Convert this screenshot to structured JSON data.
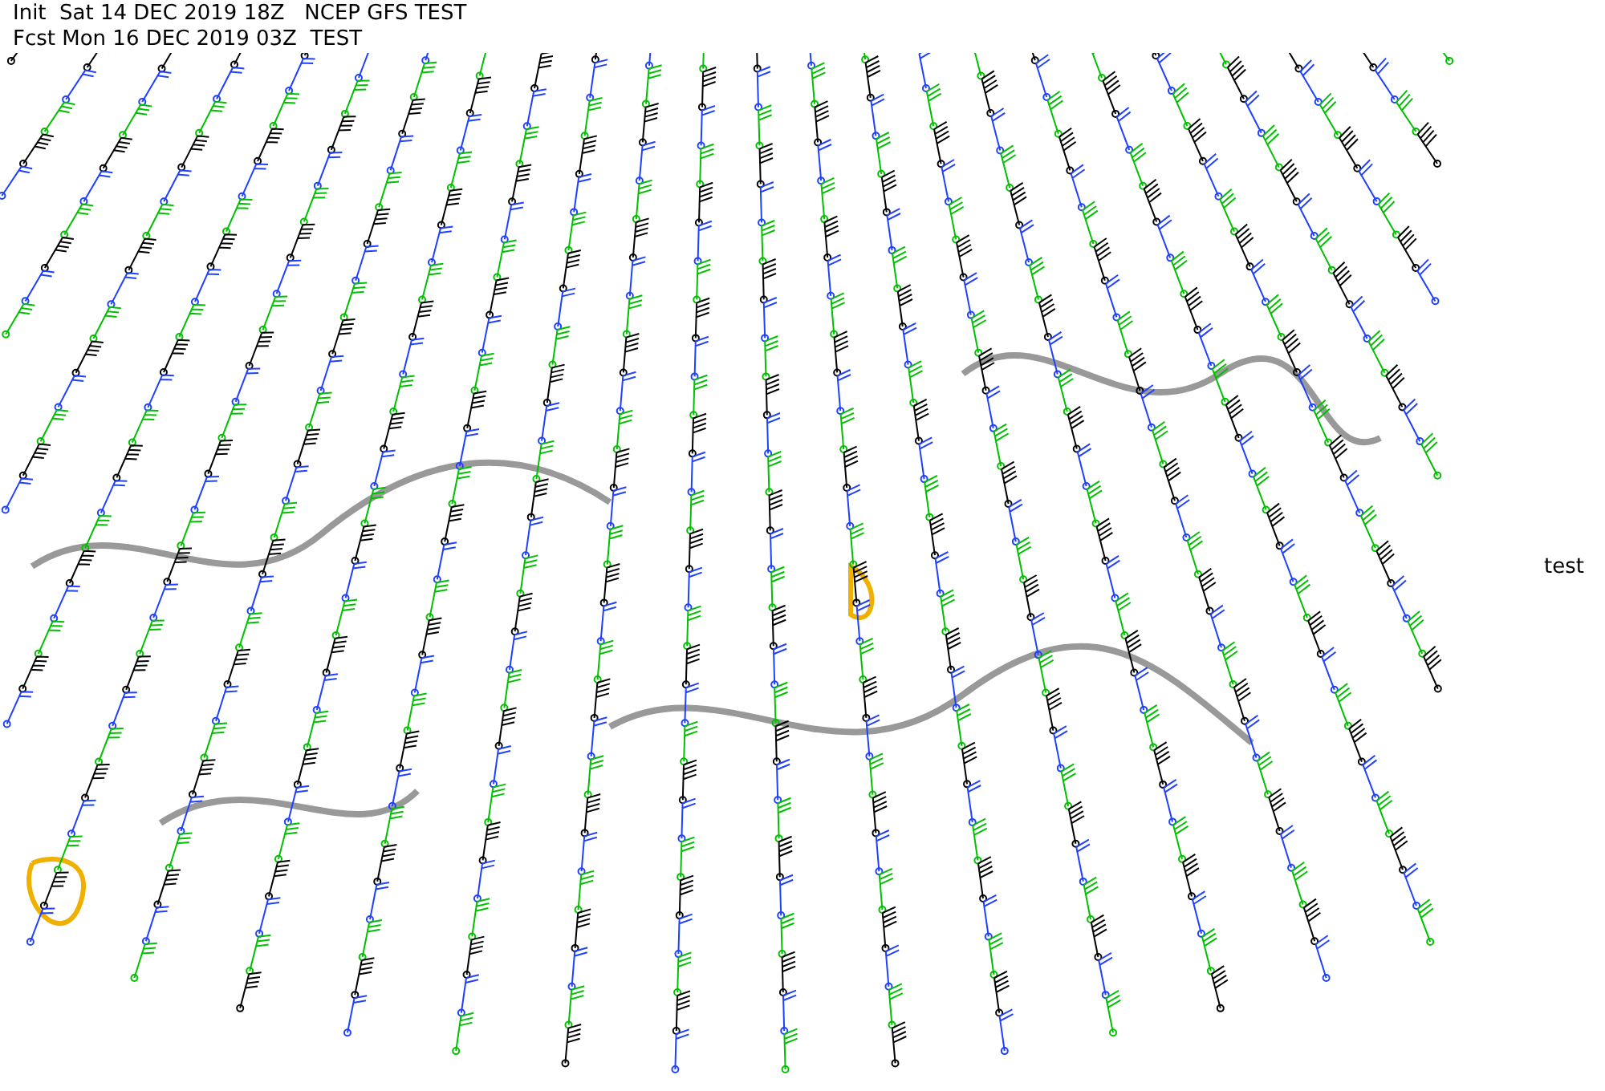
{
  "header": {
    "init_line": "Init  Sat 14 DEC 2019 18Z   NCEP GFS TEST",
    "forecast_line": "Fcst Mon 16 DEC 2019 03Z  TEST"
  },
  "side_label": "test"
}
